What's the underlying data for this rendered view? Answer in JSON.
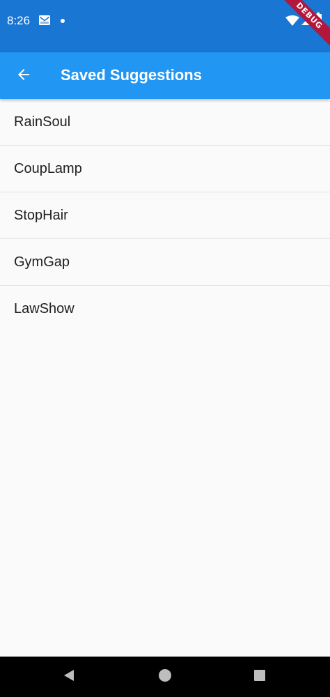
{
  "status_bar": {
    "time": "8:26",
    "icons": [
      "mail-icon",
      "notification-dot",
      "wifi-icon",
      "signal-icon",
      "battery-icon"
    ],
    "color": "#1976d2"
  },
  "debug_banner": {
    "label": "DEBUG",
    "color": "#b3173c"
  },
  "app_bar": {
    "back_icon": "arrow-back-icon",
    "title": "Saved Suggestions",
    "color": "#2196f3"
  },
  "list": {
    "items": [
      {
        "label": "RainSoul"
      },
      {
        "label": "CoupLamp"
      },
      {
        "label": "StopHair"
      },
      {
        "label": "GymGap"
      },
      {
        "label": "LawShow"
      }
    ]
  },
  "nav_bar": {
    "icons": [
      "nav-back-icon",
      "nav-home-icon",
      "nav-recent-icon"
    ]
  }
}
